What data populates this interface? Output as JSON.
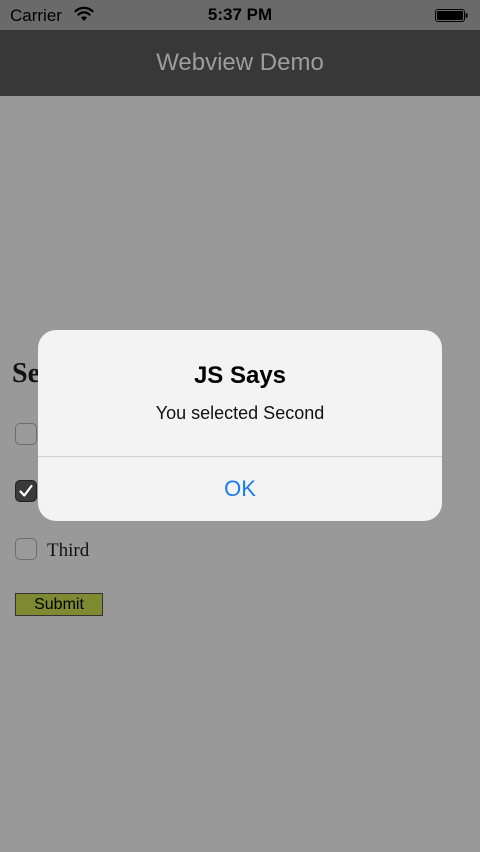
{
  "status_bar": {
    "carrier": "Carrier",
    "time": "5:37 PM",
    "wifi_icon": "wifi-icon",
    "battery_icon": "battery-icon"
  },
  "nav": {
    "title": "Webview Demo"
  },
  "page": {
    "heading": "Se",
    "options": [
      {
        "label": "",
        "checked": false
      },
      {
        "label": "",
        "checked": true
      },
      {
        "label": "Third",
        "checked": false
      }
    ],
    "submit_label": "Submit",
    "submit_color": "#7d8a31"
  },
  "alert": {
    "title": "JS Says",
    "message": "You selected Second",
    "ok_label": "OK",
    "ok_color": "#1a7cf5"
  }
}
